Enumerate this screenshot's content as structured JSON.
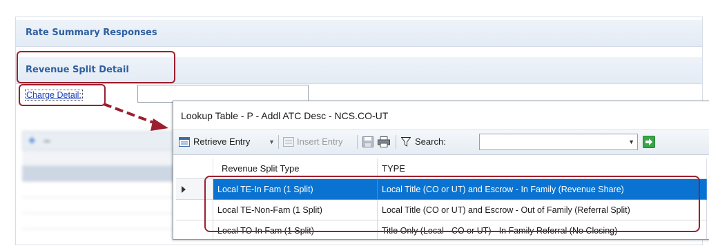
{
  "sections": {
    "rate_summary": "Rate Summary Responses",
    "revenue_split": "Revenue Split Detail"
  },
  "charge_detail": {
    "label": "Charge Detail:",
    "value": ""
  },
  "popup": {
    "title": "Lookup Table - P - Addl ATC Desc - NCS.CO-UT",
    "toolbar": {
      "retrieve_label": "Retrieve Entry",
      "insert_label": "Insert Entry",
      "search_label": "Search:",
      "search_value": ""
    },
    "columns": [
      "Revenue Split Type",
      "TYPE"
    ],
    "rows": [
      {
        "split_type": "Local TE-In Fam (1 Split)",
        "type": "Local Title (CO or UT) and Escrow - In Family (Revenue Share)",
        "selected": true
      },
      {
        "split_type": "Local TE-Non-Fam (1 Split)",
        "type": "Local Title (CO or UT) and Escrow - Out of Family (Referral Split)",
        "selected": false
      },
      {
        "split_type": "Local TO-In Fam (1 Split)",
        "type": "Title Only (Local - CO or UT) - In Family Referral (No Closing)",
        "selected": false
      }
    ]
  },
  "colors": {
    "section_text": "#2f5f9f",
    "callout": "#9b1f2e",
    "selection": "#0a73d2",
    "link": "#1a3fbf"
  },
  "icons": [
    "retrieve-entry-icon",
    "dropdown-arrow-icon",
    "insert-entry-icon",
    "save-icon",
    "print-icon",
    "filter-icon",
    "go-arrow-icon",
    "row-indicator-icon"
  ]
}
